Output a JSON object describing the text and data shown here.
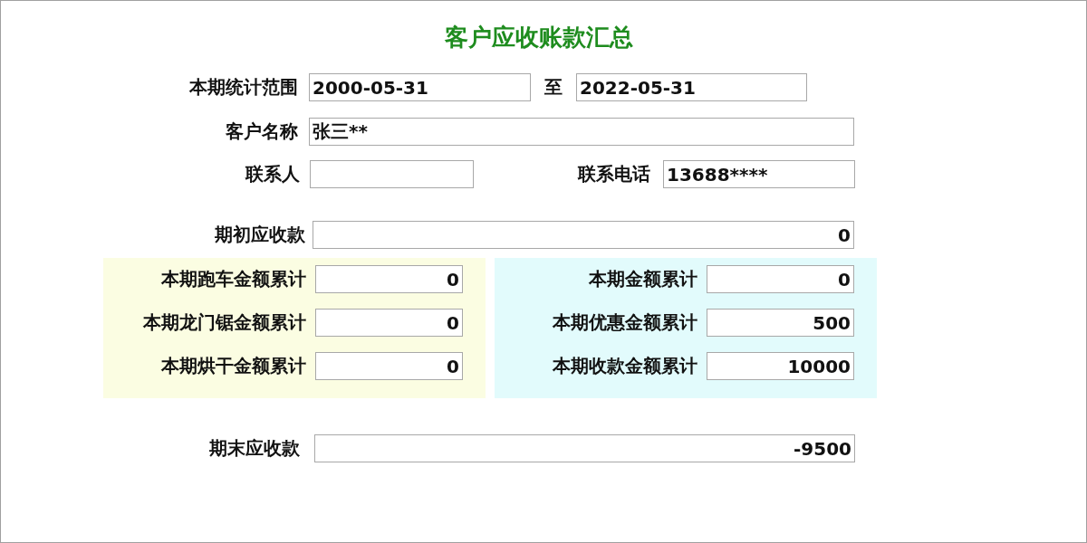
{
  "title": "客户应收账款汇总",
  "period": {
    "label": "本期统计范围",
    "from": "2000-05-31",
    "separator": "至",
    "to": "2022-05-31"
  },
  "customer": {
    "label": "客户名称",
    "value": "张三**"
  },
  "contact": {
    "label": "联系人"
  },
  "phone": {
    "label": "联系电话",
    "value": "13688****"
  },
  "opening": {
    "label": "期初应收款",
    "value": "0"
  },
  "left_panel": [
    {
      "label": "本期跑车金额累计",
      "value": "0"
    },
    {
      "label": "本期龙门锯金额累计",
      "value": "0"
    },
    {
      "label": "本期烘干金额累计",
      "value": "0"
    }
  ],
  "right_panel": [
    {
      "label": "本期金额累计",
      "value": "0"
    },
    {
      "label": "本期优惠金额累计",
      "value": "500"
    },
    {
      "label": "本期收款金额累计",
      "value": "10000"
    }
  ],
  "closing": {
    "label": "期末应收款",
    "value": "-9500"
  }
}
